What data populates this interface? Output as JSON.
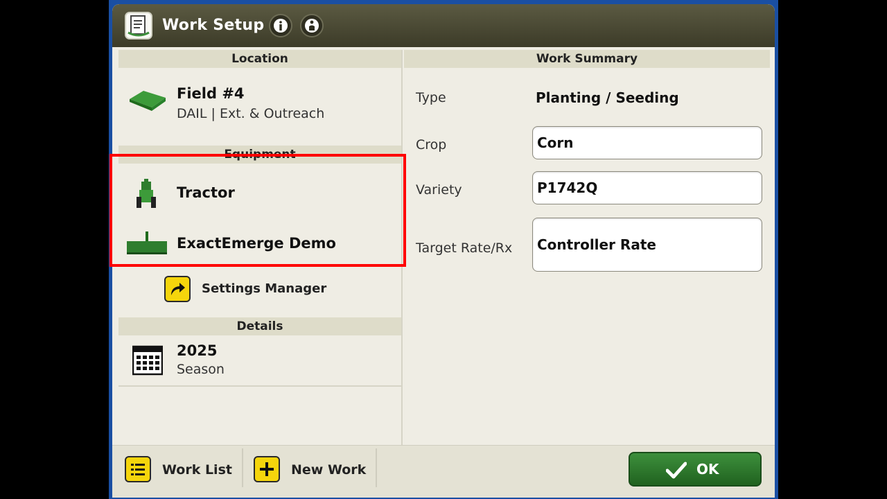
{
  "window": {
    "title": "Work Setup"
  },
  "location": {
    "header": "Location",
    "field_name": "Field #4",
    "field_sub": "DAIL | Ext. & Outreach"
  },
  "equipment": {
    "header": "Equipment",
    "tractor": "Tractor",
    "implement": "ExactEmerge Demo",
    "settings_manager": "Settings Manager"
  },
  "details": {
    "header": "Details",
    "year": "2025",
    "year_label": "Season"
  },
  "work_summary": {
    "header": "Work Summary",
    "type_label": "Type",
    "type_value": "Planting / Seeding",
    "crop_label": "Crop",
    "crop_value": "Corn",
    "variety_label": "Variety",
    "variety_value": "P1742Q",
    "target_rate_label": "Target Rate/Rx",
    "target_rate_value": "Controller Rate"
  },
  "bottom": {
    "work_list": "Work List",
    "new_work": "New Work",
    "ok": "OK"
  },
  "colors": {
    "accent_green": "#2e7d2e",
    "yellow": "#f5d50c",
    "highlight_red": "#ff0000",
    "titlebar": "#4a4934"
  }
}
